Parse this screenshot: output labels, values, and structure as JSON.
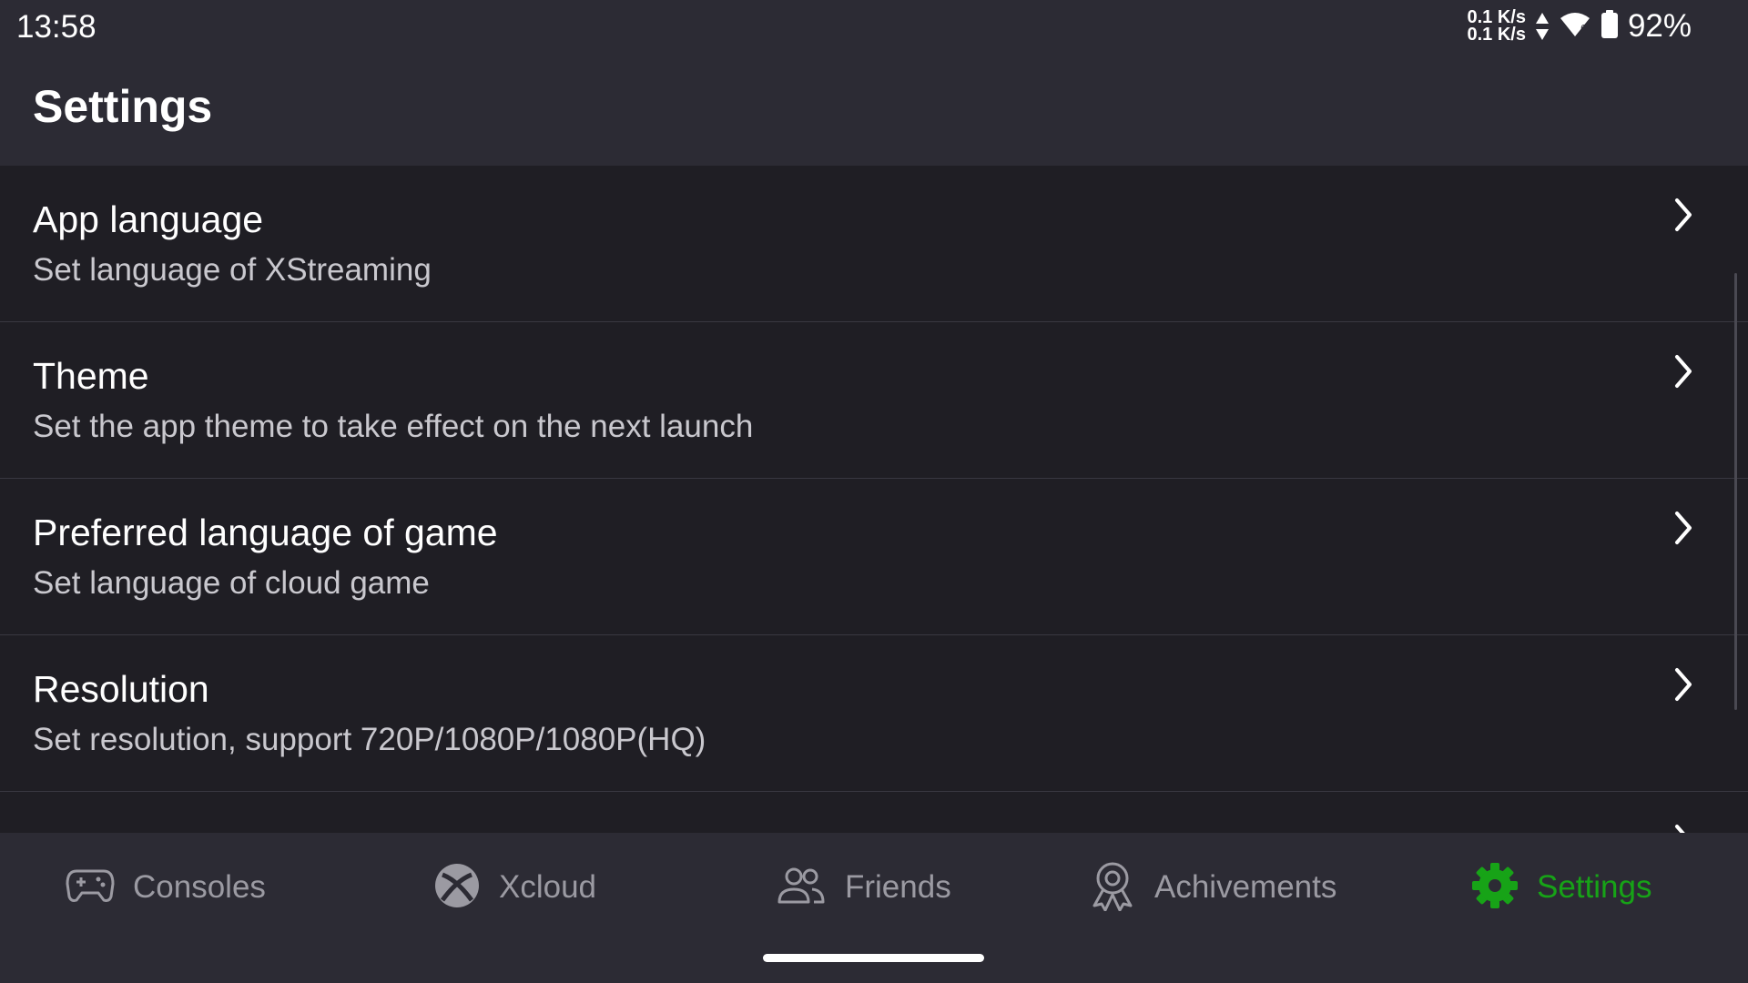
{
  "status_bar": {
    "time": "13:58",
    "upload_speed": "0.1 K/s",
    "download_speed": "0.1 K/s",
    "wifi_icon": "wifi-icon",
    "battery_icon": "battery-icon",
    "battery_percent": "92%"
  },
  "header": {
    "title": "Settings"
  },
  "settings": {
    "items": [
      {
        "title": "App language",
        "subtitle": "Set language of XStreaming"
      },
      {
        "title": "Theme",
        "subtitle": "Set the app theme to take effect on the next launch"
      },
      {
        "title": "Preferred language of game",
        "subtitle": "Set language of cloud game"
      },
      {
        "title": "Resolution",
        "subtitle": "Set resolution, support 720P/1080P/1080P(HQ)"
      }
    ]
  },
  "bottom_nav": {
    "items": [
      {
        "label": "Consoles",
        "icon": "gamepad-icon",
        "active": false
      },
      {
        "label": "Xcloud",
        "icon": "xbox-icon",
        "active": false
      },
      {
        "label": "Friends",
        "icon": "people-icon",
        "active": false
      },
      {
        "label": "Achivements",
        "icon": "award-icon",
        "active": false
      },
      {
        "label": "Settings",
        "icon": "gear-icon",
        "active": true
      }
    ]
  },
  "colors": {
    "accent": "#17a317",
    "bar_background": "#2c2b34",
    "list_background": "#1f1e24",
    "inactive_text": "#9b9aa2"
  }
}
